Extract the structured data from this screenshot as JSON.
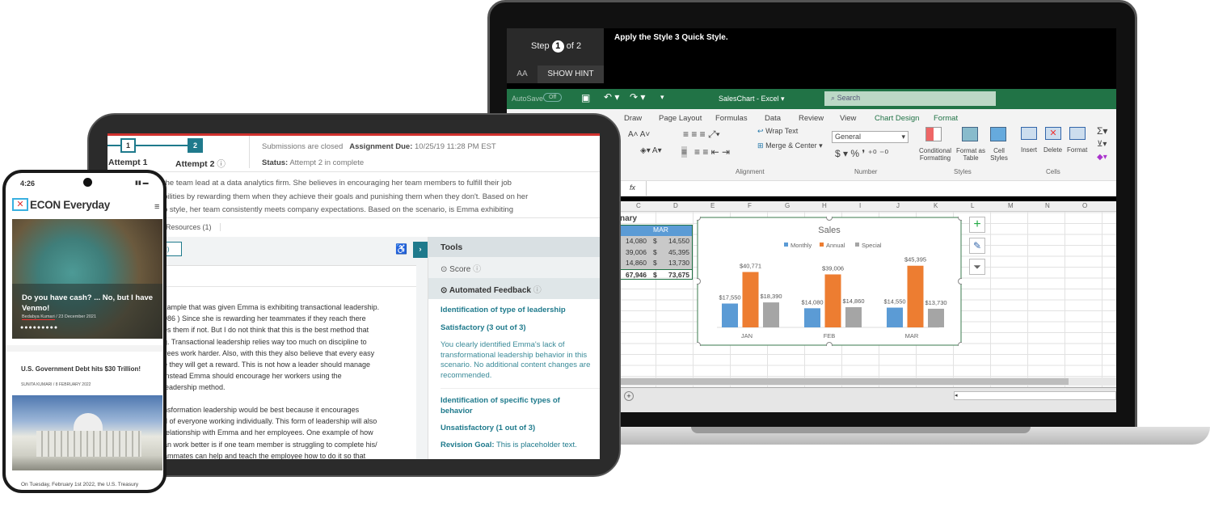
{
  "excel": {
    "step_label": "Step",
    "step_num": "1",
    "step_of": "of 2",
    "font_btn": "AA",
    "hint_btn": "SHOW HINT",
    "instruction_pre": "Apply the ",
    "instruction_bold": "Style 3",
    "instruction_post": " Quick Style.",
    "autosave": "AutoSave",
    "autosave_state": "Off",
    "title": "SalesChart - Excel",
    "search_placeholder": "Search",
    "tabs": [
      "Draw",
      "Page Layout",
      "Formulas",
      "Data",
      "Review",
      "View",
      "Chart Design",
      "Format"
    ],
    "wrap_text": "Wrap Text",
    "merge_center": "Merge & Center",
    "number_format": "General",
    "conditional": "Conditional Formatting",
    "format_table": "Format as Table",
    "cell_styles": "Cell Styles",
    "insert": "Insert",
    "delete": "Delete",
    "format": "Format",
    "groups": [
      "Alignment",
      "Number",
      "Styles",
      "Cells"
    ],
    "fx": "fx",
    "columns": [
      "C",
      "D",
      "E",
      "F",
      "G",
      "H",
      "I",
      "J",
      "K",
      "L",
      "M",
      "N",
      "O"
    ],
    "table_title": "nary",
    "header_mar": "MAR",
    "rows": [
      [
        "14,080",
        "$",
        "14,550"
      ],
      [
        "39,006",
        "$",
        "45,395"
      ],
      [
        "14,860",
        "$",
        "13,730"
      ],
      [
        "67,946",
        "$",
        "73,675"
      ]
    ],
    "colors": {
      "green": "#217346"
    }
  },
  "chart_data": {
    "type": "bar",
    "title": "Sales",
    "categories": [
      "JAN",
      "FEB",
      "MAR"
    ],
    "series": [
      {
        "name": "Monthly",
        "values": [
          17550,
          14080,
          14550
        ],
        "color": "#5b9bd5"
      },
      {
        "name": "Annual",
        "values": [
          40771,
          39006,
          45395
        ],
        "color": "#ed7d31"
      },
      {
        "name": "Special",
        "values": [
          18390,
          14860,
          13730
        ],
        "color": "#a5a5a5"
      }
    ],
    "data_labels": true,
    "legend": "top",
    "ylim": [
      0,
      50000
    ],
    "grid": false
  },
  "tablet": {
    "step1": "1",
    "step2": "2",
    "attempt1": "Attempt 1",
    "attempt2": "Attempt 2",
    "closed": "Submissions are closed",
    "due_label": "Assignment Due:",
    "due_value": "10/25/19 11:28 PM EST",
    "status_label": "Status:",
    "status_value": "Attempt 2 in complete",
    "question": [
      "the team lead at a data analytics firm. She believes in encouraging her team members to fulfill their job",
      "bilities by rewarding them when they achieve their goals and punishing them when they don't. Based on her",
      "p style, her team consistently meets company expectations. Based on the scenario, is Emma exhibiting"
    ],
    "resources_tab": "Resources (1)",
    "attempt_btn": "2)",
    "essay1": [
      "xample that was given Emma is exhibiting transactional leadership.",
      "986 ) Since she is rewarding her teammates if they reach there",
      "es them if not. But I do not think that this is the best method that",
      "g. Transactional leadership relies way too much on discipline to",
      "yees work harder. Also, with this they also believe that every easy",
      "e they will get a reward. This is not how a leader should manage",
      "Instead Emma should encourage her workers using the",
      "leadership method."
    ],
    "essay2": [
      "nsformation leadership would be best because it encourages",
      "d of everyone working individually. This form of leadership will also",
      "relationship with Emma and her employees. One example of how",
      "an work better is if one team member is struggling to complete his/",
      "ammates can help and teach the employee how to do it so that"
    ],
    "tools": "Tools",
    "score": "Score",
    "feedback": "Automated Feedback",
    "crit1": "Identification of type of leadership",
    "rating1": "Satisfactory (3 out of 3)",
    "comment1": "You clearly identified Emma's lack of transformational leadership behavior in this scenario. No additional content changes are recommended.",
    "crit2": "Identification of specific types of behavior",
    "rating2": "Unsatisfactory (1 out of 3)",
    "revision_label": "Revision Goal:",
    "revision_text": "This is placeholder text."
  },
  "phone": {
    "time": "4:26",
    "brand": "ECON Everyday",
    "hero_title": "Do you have cash? ... No, but I have Venmo!",
    "hero_author": "Bedabya Kumari",
    "hero_date": "/ 23 December 2021",
    "article_title": "U.S. Government Debt hits $30 Trillion!",
    "article_author": "SUNITA KUMARI",
    "article_date": "/   8 FEBRUARY 2022",
    "article_snippet": "On Tuesday, February 1st 2022, the U.S. Treasury"
  }
}
